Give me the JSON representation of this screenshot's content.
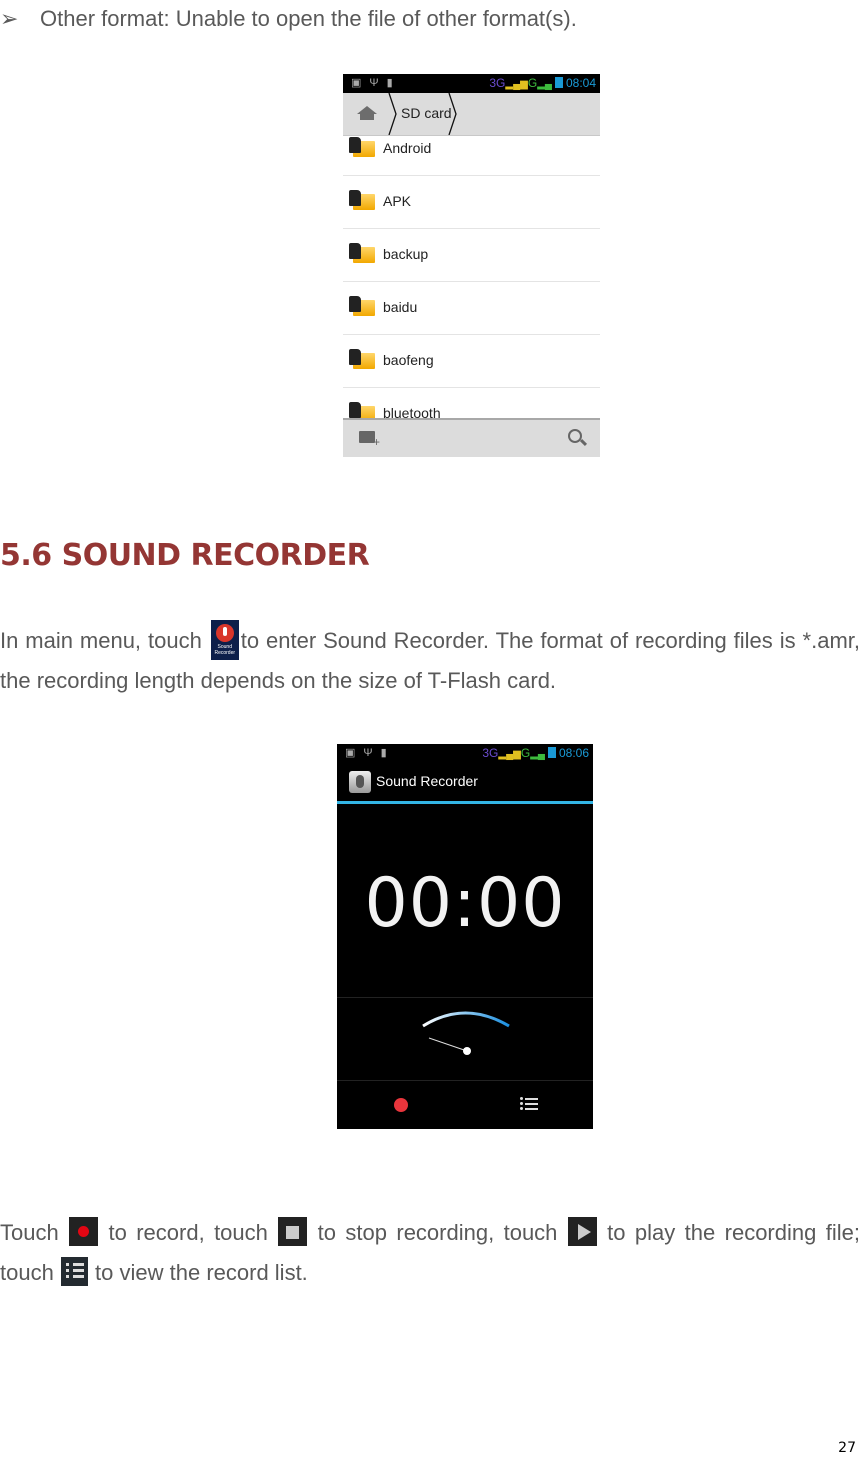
{
  "bullet": {
    "text": "Other format: Unable to open the file of other format(s)."
  },
  "file_manager_screenshot": {
    "status_bar": {
      "network": "3G",
      "network2": "G",
      "time": "08:04"
    },
    "breadcrumb": {
      "current": "SD card"
    },
    "files": [
      {
        "name": "Android"
      },
      {
        "name": "APK"
      },
      {
        "name": "backup"
      },
      {
        "name": "baidu"
      },
      {
        "name": "baofeng"
      },
      {
        "name": "bluetooth"
      }
    ]
  },
  "section": {
    "heading": "5.6 SOUND RECORDER"
  },
  "intro": {
    "part1": "In main menu, touch ",
    "app_icon_label": "Sound Recorder",
    "part2": "to enter Sound Recorder. The format of recording files is *.amr, the recording length depends on the size of T-Flash card."
  },
  "recorder_screenshot": {
    "status_bar": {
      "network": "3G",
      "network2": "G",
      "time": "08:06"
    },
    "title": "Sound Recorder",
    "timer": "00:00"
  },
  "instructions": {
    "t1": "Touch ",
    "t2": " to record, touch ",
    "t3": " to stop recording, touch ",
    "t4": " to play the recording file; touch ",
    "t5": "  to view the record list."
  },
  "page_number": "27"
}
